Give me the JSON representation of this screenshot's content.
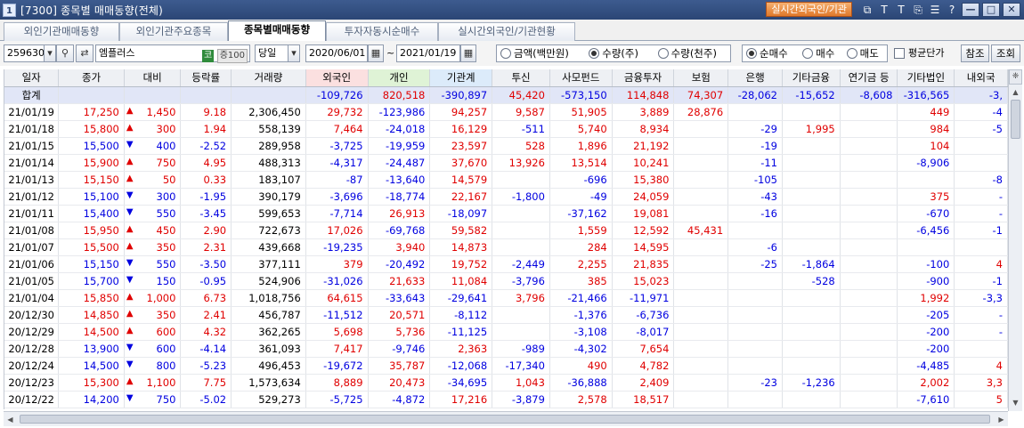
{
  "window": {
    "title": "[7300] 종목별 매매동향(전체)",
    "logo": "1",
    "realtime_link": "실시간외국인/기관",
    "icons": [
      "popout-icon",
      "text-icon",
      "T-icon",
      "copy-icon",
      "list-icon",
      "help-icon"
    ],
    "icon_glyphs": [
      "⧉",
      "T",
      "T",
      "⎘",
      "☰",
      "?"
    ],
    "win_buttons": [
      "—",
      "□",
      "✕"
    ]
  },
  "tabs": [
    {
      "label": "외인기관매매동향",
      "active": false
    },
    {
      "label": "외인기관주요종목",
      "active": false
    },
    {
      "label": "종목별매매동향",
      "active": true
    },
    {
      "label": "투자자동시순매수",
      "active": false
    },
    {
      "label": "실시간외국인/기관현황",
      "active": false
    }
  ],
  "toolbar": {
    "code": "259630",
    "name": "엠플러스",
    "market_badge": "코",
    "group_badge": "증100",
    "period": "당일",
    "date_from": "2020/06/01",
    "date_sep": "~",
    "date_to": "2021/01/19",
    "unit_options": [
      {
        "label": "금액(백만원)",
        "selected": false
      },
      {
        "label": "수량(주)",
        "selected": true
      },
      {
        "label": "수량(천주)",
        "selected": false
      }
    ],
    "type_options": [
      {
        "label": "순매수",
        "selected": true
      },
      {
        "label": "매수",
        "selected": false
      },
      {
        "label": "매도",
        "selected": false
      }
    ],
    "avg_price_label": "평균단가",
    "ref_button": "참조",
    "query_button": "조회"
  },
  "table": {
    "columns": [
      "일자",
      "종가",
      "대비",
      "등락률",
      "거래량",
      "외국인",
      "개인",
      "기관계",
      "투신",
      "사모펀드",
      "금융투자",
      "보험",
      "은행",
      "기타금융",
      "연기금 등",
      "기타법인",
      "내외국"
    ],
    "summary": {
      "label": "합계",
      "values": [
        "",
        "",
        "",
        "",
        "-109,726",
        "820,518",
        "-390,897",
        "45,420",
        "-573,150",
        "114,848",
        "74,307",
        "-28,062",
        "-15,652",
        "-8,608",
        "-316,565",
        "-3,"
      ]
    },
    "rows": [
      {
        "date": "21/01/19",
        "close": "17,250",
        "dir": "up",
        "chg": "1,450",
        "rate": "9.18",
        "vol": "2,306,450",
        "vals": [
          "29,732",
          "-123,986",
          "94,257",
          "9,587",
          "51,905",
          "3,889",
          "28,876",
          "",
          "",
          "",
          "449",
          "-4"
        ]
      },
      {
        "date": "21/01/18",
        "close": "15,800",
        "dir": "up",
        "chg": "300",
        "rate": "1.94",
        "vol": "558,139",
        "vals": [
          "7,464",
          "-24,018",
          "16,129",
          "-511",
          "5,740",
          "8,934",
          "",
          "-29",
          "1,995",
          "",
          "984",
          "-5"
        ]
      },
      {
        "date": "21/01/15",
        "close": "15,500",
        "dir": "dn",
        "chg": "400",
        "rate": "-2.52",
        "vol": "289,958",
        "vals": [
          "-3,725",
          "-19,959",
          "23,597",
          "528",
          "1,896",
          "21,192",
          "",
          "-19",
          "",
          "",
          "104",
          ""
        ]
      },
      {
        "date": "21/01/14",
        "close": "15,900",
        "dir": "up",
        "chg": "750",
        "rate": "4.95",
        "vol": "488,313",
        "vals": [
          "-4,317",
          "-24,487",
          "37,670",
          "13,926",
          "13,514",
          "10,241",
          "",
          "-11",
          "",
          "",
          "-8,906",
          ""
        ]
      },
      {
        "date": "21/01/13",
        "close": "15,150",
        "dir": "up",
        "chg": "50",
        "rate": "0.33",
        "vol": "183,107",
        "vals": [
          "-87",
          "-13,640",
          "14,579",
          "",
          "-696",
          "15,380",
          "",
          "-105",
          "",
          "",
          "",
          "-8"
        ]
      },
      {
        "date": "21/01/12",
        "close": "15,100",
        "dir": "dn",
        "chg": "300",
        "rate": "-1.95",
        "vol": "390,179",
        "vals": [
          "-3,696",
          "-18,774",
          "22,167",
          "-1,800",
          "-49",
          "24,059",
          "",
          "-43",
          "",
          "",
          "375",
          "-"
        ]
      },
      {
        "date": "21/01/11",
        "close": "15,400",
        "dir": "dn",
        "chg": "550",
        "rate": "-3.45",
        "vol": "599,653",
        "vals": [
          "-7,714",
          "26,913",
          "-18,097",
          "",
          "-37,162",
          "19,081",
          "",
          "-16",
          "",
          "",
          "-670",
          "-"
        ]
      },
      {
        "date": "21/01/08",
        "close": "15,950",
        "dir": "up",
        "chg": "450",
        "rate": "2.90",
        "vol": "722,673",
        "vals": [
          "17,026",
          "-69,768",
          "59,582",
          "",
          "1,559",
          "12,592",
          "45,431",
          "",
          "",
          "",
          "-6,456",
          "-1"
        ]
      },
      {
        "date": "21/01/07",
        "close": "15,500",
        "dir": "up",
        "chg": "350",
        "rate": "2.31",
        "vol": "439,668",
        "vals": [
          "-19,235",
          "3,940",
          "14,873",
          "",
          "284",
          "14,595",
          "",
          "-6",
          "",
          "",
          "",
          ""
        ]
      },
      {
        "date": "21/01/06",
        "close": "15,150",
        "dir": "dn",
        "chg": "550",
        "rate": "-3.50",
        "vol": "377,111",
        "vals": [
          "379",
          "-20,492",
          "19,752",
          "-2,449",
          "2,255",
          "21,835",
          "",
          "-25",
          "-1,864",
          "",
          "-100",
          "4"
        ]
      },
      {
        "date": "21/01/05",
        "close": "15,700",
        "dir": "dn",
        "chg": "150",
        "rate": "-0.95",
        "vol": "524,906",
        "vals": [
          "-31,026",
          "21,633",
          "11,084",
          "-3,796",
          "385",
          "15,023",
          "",
          "",
          "-528",
          "",
          "-900",
          "-1"
        ]
      },
      {
        "date": "21/01/04",
        "close": "15,850",
        "dir": "up",
        "chg": "1,000",
        "rate": "6.73",
        "vol": "1,018,756",
        "vals": [
          "64,615",
          "-33,643",
          "-29,641",
          "3,796",
          "-21,466",
          "-11,971",
          "",
          "",
          "",
          "",
          "1,992",
          "-3,3"
        ]
      },
      {
        "date": "20/12/30",
        "close": "14,850",
        "dir": "up",
        "chg": "350",
        "rate": "2.41",
        "vol": "456,787",
        "vals": [
          "-11,512",
          "20,571",
          "-8,112",
          "",
          "-1,376",
          "-6,736",
          "",
          "",
          "",
          "",
          "-205",
          "-"
        ]
      },
      {
        "date": "20/12/29",
        "close": "14,500",
        "dir": "up",
        "chg": "600",
        "rate": "4.32",
        "vol": "362,265",
        "vals": [
          "5,698",
          "5,736",
          "-11,125",
          "",
          "-3,108",
          "-8,017",
          "",
          "",
          "",
          "",
          "-200",
          "-"
        ]
      },
      {
        "date": "20/12/28",
        "close": "13,900",
        "dir": "dn",
        "chg": "600",
        "rate": "-4.14",
        "vol": "361,093",
        "vals": [
          "7,417",
          "-9,746",
          "2,363",
          "-989",
          "-4,302",
          "7,654",
          "",
          "",
          "",
          "",
          "-200",
          ""
        ]
      },
      {
        "date": "20/12/24",
        "close": "14,500",
        "dir": "dn",
        "chg": "800",
        "rate": "-5.23",
        "vol": "496,453",
        "vals": [
          "-19,672",
          "35,787",
          "-12,068",
          "-17,340",
          "490",
          "4,782",
          "",
          "",
          "",
          "",
          "-4,485",
          "4"
        ]
      },
      {
        "date": "20/12/23",
        "close": "15,300",
        "dir": "up",
        "chg": "1,100",
        "rate": "7.75",
        "vol": "1,573,634",
        "vals": [
          "8,889",
          "20,473",
          "-34,695",
          "1,043",
          "-36,888",
          "2,409",
          "",
          "-23",
          "-1,236",
          "",
          "2,002",
          "3,3"
        ]
      },
      {
        "date": "20/12/22",
        "close": "14,200",
        "dir": "dn",
        "chg": "750",
        "rate": "-5.02",
        "vol": "529,273",
        "vals": [
          "-5,725",
          "-4,872",
          "17,216",
          "-3,879",
          "2,578",
          "18,517",
          "",
          "",
          "",
          "",
          "-7,610",
          "5"
        ]
      }
    ]
  },
  "scroll": {
    "corner_icon": "❈"
  }
}
